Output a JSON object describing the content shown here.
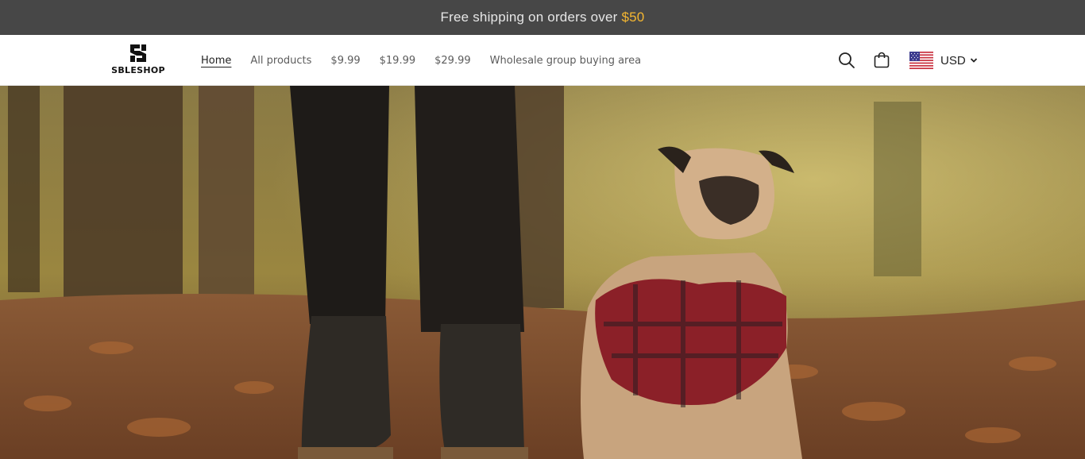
{
  "announcement": {
    "text": "Free shipping on orders over",
    "amount": "$50"
  },
  "header": {
    "logo_text": "SBLESHOP",
    "nav": [
      {
        "label": "Home",
        "active": true
      },
      {
        "label": "All products"
      },
      {
        "label": "$9.99"
      },
      {
        "label": "$19.99"
      },
      {
        "label": "$29.99"
      },
      {
        "label": "Wholesale group buying area"
      }
    ],
    "icons": {
      "search": "search-icon",
      "cart": "cart-icon",
      "flag": "us-flag-icon",
      "chevron": "chevron-down-icon"
    },
    "currency": "USD"
  },
  "colors": {
    "announcement_bg": "#474747",
    "announcement_amount": "#f5b731",
    "header_bg": "#ffffff"
  }
}
